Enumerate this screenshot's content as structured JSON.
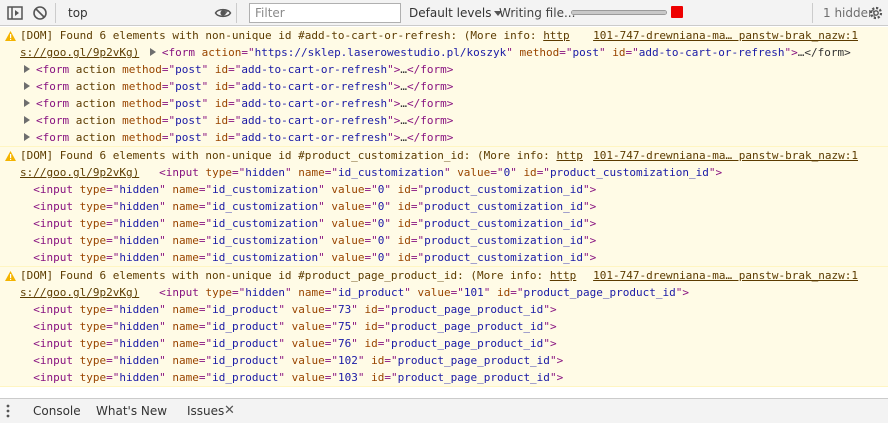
{
  "toolbar": {
    "context": "top",
    "filter_placeholder": "Filter",
    "levels_label": "Default levels",
    "status_text": "Writing file...",
    "progress": 1.0,
    "hidden_label": "1 hidden",
    "colors": {
      "stop": "#e00000",
      "bg": "#f3f3f3"
    }
  },
  "messages": [
    {
      "line1": "[DOM] Found 6 elements with non-unique id #add-to-cart-or-refresh: (More info: ",
      "link_a": "http",
      "source": "101-747-drewniana-ma… panstw-brak_nazw:1",
      "link_b": "s://goo.gl/9p2vKg)",
      "first_node": {
        "tag": "form",
        "attrs": [
          {
            "name": "action",
            "value": "https://sklep.laserowestudio.pl/koszyk"
          },
          {
            "name": "method",
            "value": "post"
          },
          {
            "name": "id",
            "value": "add-to-cart-or-refresh"
          }
        ],
        "tail": "…</form>"
      },
      "nodes": [
        {
          "expandable": true,
          "text": "<form action method=\"post\" id=\"add-to-cart-or-refresh\">…</form>"
        },
        {
          "expandable": true,
          "text": "<form action method=\"post\" id=\"add-to-cart-or-refresh\">…</form>"
        },
        {
          "expandable": true,
          "text": "<form action method=\"post\" id=\"add-to-cart-or-refresh\">…</form>"
        },
        {
          "expandable": true,
          "text": "<form action method=\"post\" id=\"add-to-cart-or-refresh\">…</form>"
        },
        {
          "expandable": true,
          "text": "<form action method=\"post\" id=\"add-to-cart-or-refresh\">…</form>"
        }
      ]
    },
    {
      "line1": "[DOM] Found 6 elements with non-unique id #product_customization_id: (More info: ",
      "link_a": "http",
      "source": "101-747-drewniana-ma… panstw-brak_nazw:1",
      "link_b": "s://goo.gl/9p2vKg)",
      "first_text": "<input type=\"hidden\" name=\"id_customization\" value=\"0\" id=\"product_customization_id\">",
      "nodes": [
        {
          "expandable": false,
          "text": "<input type=\"hidden\" name=\"id_customization\" value=\"0\" id=\"product_customization_id\">"
        },
        {
          "expandable": false,
          "text": "<input type=\"hidden\" name=\"id_customization\" value=\"0\" id=\"product_customization_id\">"
        },
        {
          "expandable": false,
          "text": "<input type=\"hidden\" name=\"id_customization\" value=\"0\" id=\"product_customization_id\">"
        },
        {
          "expandable": false,
          "text": "<input type=\"hidden\" name=\"id_customization\" value=\"0\" id=\"product_customization_id\">"
        },
        {
          "expandable": false,
          "text": "<input type=\"hidden\" name=\"id_customization\" value=\"0\" id=\"product_customization_id\">"
        }
      ]
    },
    {
      "line1": "[DOM] Found 6 elements with non-unique id #product_page_product_id: (More info: ",
      "link_a": "http",
      "source": "101-747-drewniana-ma… panstw-brak_nazw:1",
      "link_b": "s://goo.gl/9p2vKg)",
      "first_text": "<input type=\"hidden\" name=\"id_product\" value=\"101\" id=\"product_page_product_id\">",
      "nodes": [
        {
          "expandable": false,
          "text": "<input type=\"hidden\" name=\"id_product\" value=\"73\" id=\"product_page_product_id\">"
        },
        {
          "expandable": false,
          "text": "<input type=\"hidden\" name=\"id_product\" value=\"75\" id=\"product_page_product_id\">"
        },
        {
          "expandable": false,
          "text": "<input type=\"hidden\" name=\"id_product\" value=\"76\" id=\"product_page_product_id\">"
        },
        {
          "expandable": false,
          "text": "<input type=\"hidden\" name=\"id_product\" value=\"102\" id=\"product_page_product_id\">"
        },
        {
          "expandable": false,
          "text": "<input type=\"hidden\" name=\"id_product\" value=\"103\" id=\"product_page_product_id\">"
        }
      ]
    }
  ],
  "drawer": {
    "tabs": [
      "Console",
      "What's New",
      "Issues"
    ],
    "close_glyph": "✕"
  }
}
